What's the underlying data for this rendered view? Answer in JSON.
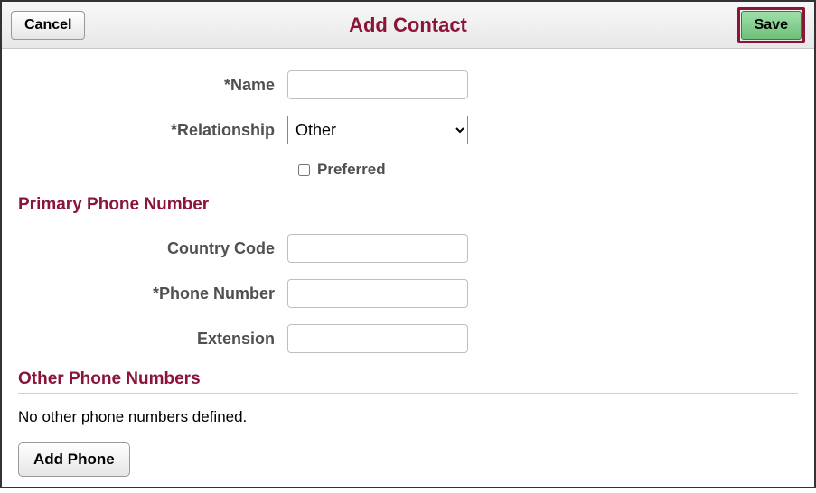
{
  "header": {
    "cancel_label": "Cancel",
    "title": "Add Contact",
    "save_label": "Save"
  },
  "form": {
    "name_label": "*Name",
    "name_value": "",
    "relationship_label": "*Relationship",
    "relationship_value": "Other",
    "preferred_label": "Preferred",
    "preferred_checked": false
  },
  "sections": {
    "primary_phone_title": "Primary Phone Number",
    "country_code_label": "Country Code",
    "country_code_value": "",
    "phone_number_label": "*Phone Number",
    "phone_number_value": "",
    "extension_label": "Extension",
    "extension_value": "",
    "other_phone_title": "Other Phone Numbers",
    "no_other_msg": "No other phone numbers defined.",
    "add_phone_label": "Add Phone"
  }
}
